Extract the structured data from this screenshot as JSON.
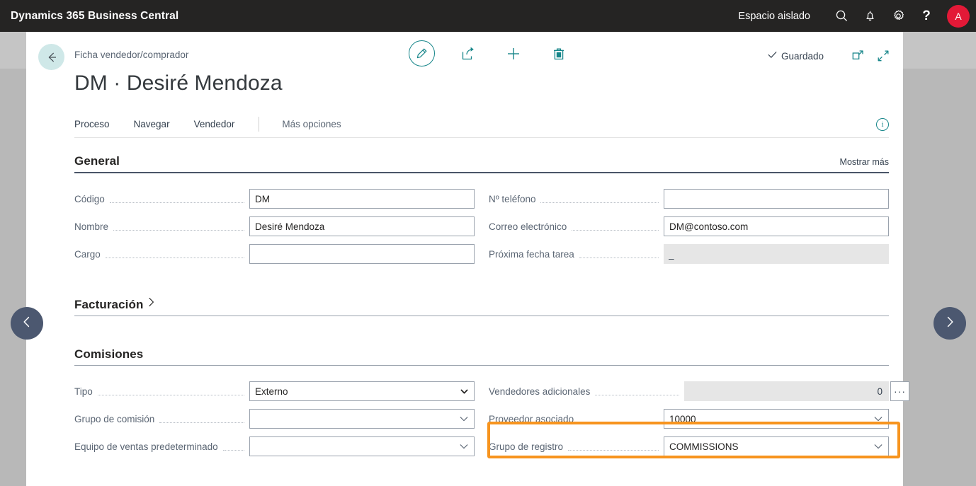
{
  "topbar": {
    "brand": "Dynamics 365 Business Central",
    "company": "Espacio aislado",
    "search_icon": "search-icon",
    "notifications_icon": "bell-icon",
    "settings_icon": "gear-icon",
    "help_label": "?",
    "avatar_initial": "A"
  },
  "commandbar": {
    "back_icon": "arrow-left-icon",
    "breadcrumb": "Ficha vendedor/comprador",
    "edit_icon": "pencil-icon",
    "share_icon": "share-icon",
    "new_icon": "plus-icon",
    "delete_icon": "trash-icon",
    "saved_label": "Guardado",
    "saved_icon": "checkmark-icon",
    "open_new_window_icon": "open-in-new-window-icon",
    "collapse_icon": "collapse-arrows-icon"
  },
  "page": {
    "title": "DM · Desiré Mendoza"
  },
  "actions": {
    "items": [
      {
        "label": "Proceso"
      },
      {
        "label": "Navegar"
      },
      {
        "label": "Vendedor"
      }
    ],
    "more_label": "Más opciones",
    "info_icon": "info-icon",
    "info_glyph": "i"
  },
  "general": {
    "title": "General",
    "show_more_label": "Mostrar más",
    "left_fields": [
      {
        "label": "Código",
        "value": "DM",
        "type": "text"
      },
      {
        "label": "Nombre",
        "value": "Desiré Mendoza",
        "type": "text"
      },
      {
        "label": "Cargo",
        "value": "",
        "type": "text"
      }
    ],
    "right_fields": [
      {
        "label": "Nº teléfono",
        "value": "",
        "type": "text"
      },
      {
        "label": "Correo electrónico",
        "value": "DM@contoso.com",
        "type": "text"
      },
      {
        "label": "Próxima fecha tarea",
        "value": "_",
        "type": "readonly"
      }
    ]
  },
  "facturacion": {
    "title": "Facturación",
    "expand_icon": "chevron-right-icon"
  },
  "comisiones": {
    "title": "Comisiones",
    "left_fields": [
      {
        "label": "Tipo",
        "value": "Externo",
        "type": "select"
      },
      {
        "label": "Grupo de comisión",
        "value": "",
        "type": "lookup"
      },
      {
        "label": "Equipo de ventas predeterminado",
        "value": "",
        "type": "lookup"
      }
    ],
    "right_fields": [
      {
        "label": "Vendedores adicionales",
        "value": "0",
        "type": "readonly-assist",
        "assist_label": "···"
      },
      {
        "label": "Proveedor asociado",
        "value": "10000",
        "type": "lookup"
      },
      {
        "label": "Grupo de registro",
        "value": "COMMISSIONS",
        "type": "lookup",
        "highlighted": true
      }
    ]
  },
  "navigation": {
    "prev_icon": "chevron-left-icon",
    "next_icon": "chevron-right-icon"
  },
  "colors": {
    "topbar_bg": "#252423",
    "accent_teal": "#17868a",
    "highlight_orange": "#f7941e",
    "avatar_red": "#e31937",
    "nav_circle": "#4c5870",
    "back_circle": "#cfe8e8"
  }
}
